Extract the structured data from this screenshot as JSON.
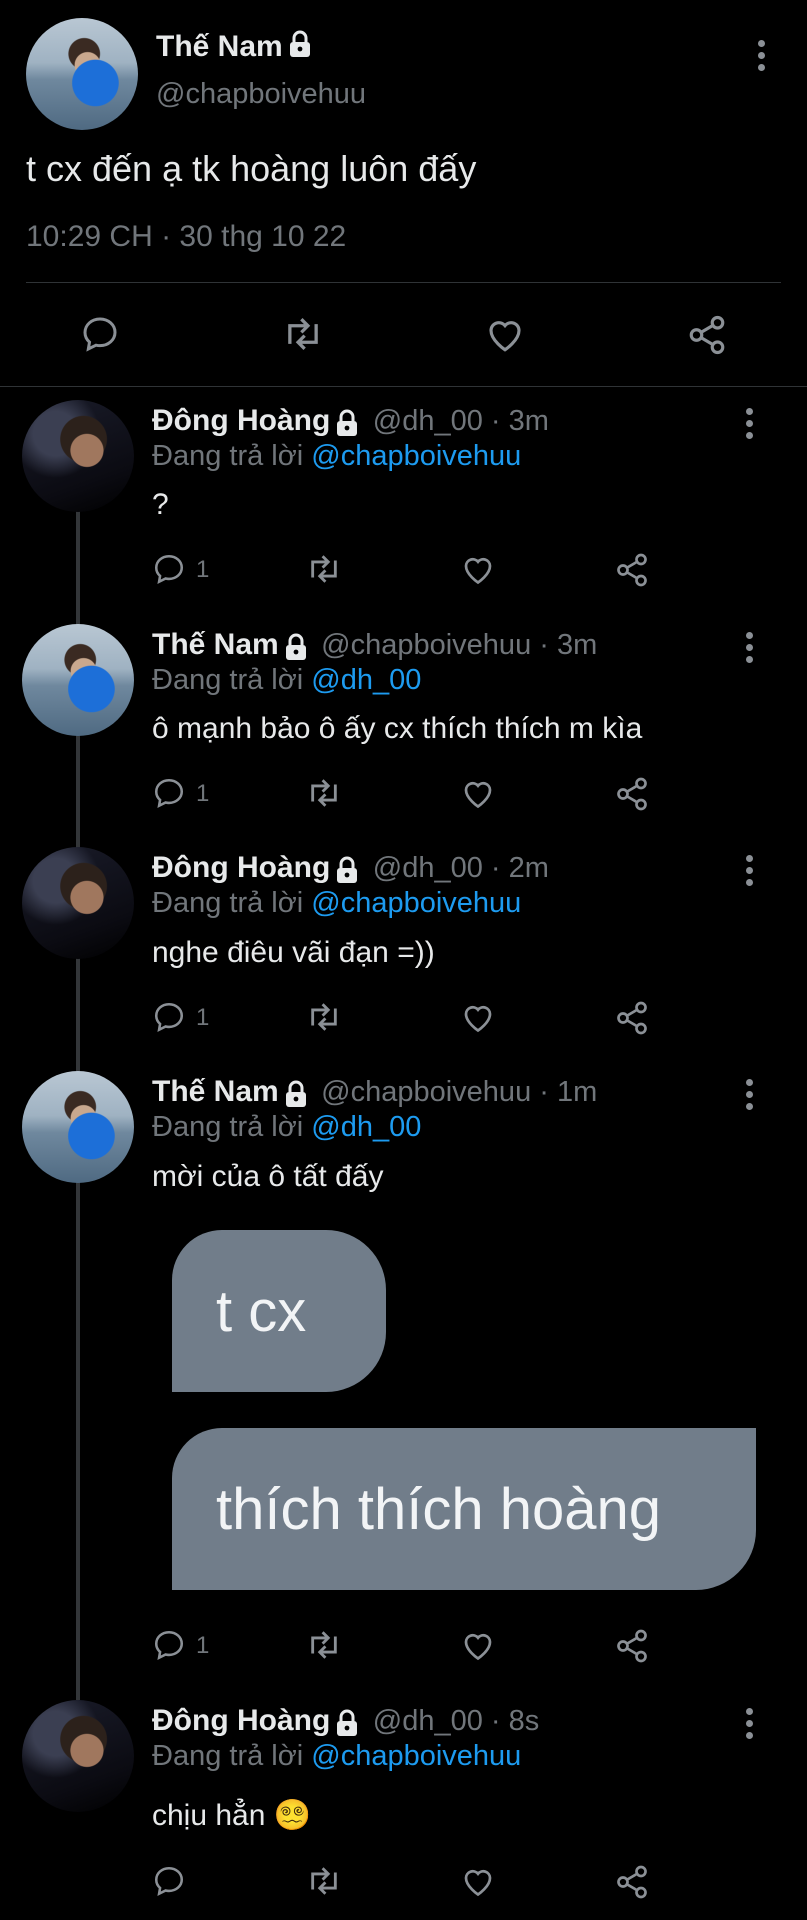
{
  "main_tweet": {
    "name": "Thế Nam",
    "handle": "@chapboivehuu",
    "text": "t cx đến ạ tk hoàng luôn đấy",
    "timestamp": "10:29 CH · 30 thg 10 22"
  },
  "replies": [
    {
      "name": "Đông Hoàng",
      "meta": "@dh_00 · 3m",
      "replying_prefix": "Đang trả lời",
      "replying_to": "@chapboivehuu",
      "text": "?",
      "reply_count": "1"
    },
    {
      "name": "Thế Nam",
      "meta": "@chapboivehuu · 3m",
      "replying_prefix": "Đang trả lời",
      "replying_to": "@dh_00",
      "text": "ô mạnh bảo ô ấy cx thích thích m kìa",
      "reply_count": "1"
    },
    {
      "name": "Đông Hoàng",
      "meta": "@dh_00 · 2m",
      "replying_prefix": "Đang trả lời",
      "replying_to": "@chapboivehuu",
      "text": "nghe điêu vãi đạn =))",
      "reply_count": "1"
    },
    {
      "name": "Thế Nam",
      "meta": "@chapboivehuu · 1m",
      "replying_prefix": "Đang trả lời",
      "replying_to": "@dh_00",
      "text": "mời của ô tất đấy",
      "reply_count": "1",
      "bubbles": [
        "t cx",
        "thích thích hoàng"
      ]
    },
    {
      "name": "Đông Hoàng",
      "meta": "@dh_00 · 8s",
      "replying_prefix": "Đang trả lời",
      "replying_to": "@chapboivehuu",
      "text": "chịu hẳn 😵‍💫",
      "reply_count": ""
    }
  ],
  "icons": [
    "reply-icon",
    "retweet-icon",
    "like-icon",
    "share-icon",
    "lock-icon",
    "more-icon"
  ],
  "colors": {
    "background": "#000000",
    "link": "#1d9bf0",
    "muted": "#71767b",
    "bubble": "#717d8a"
  }
}
